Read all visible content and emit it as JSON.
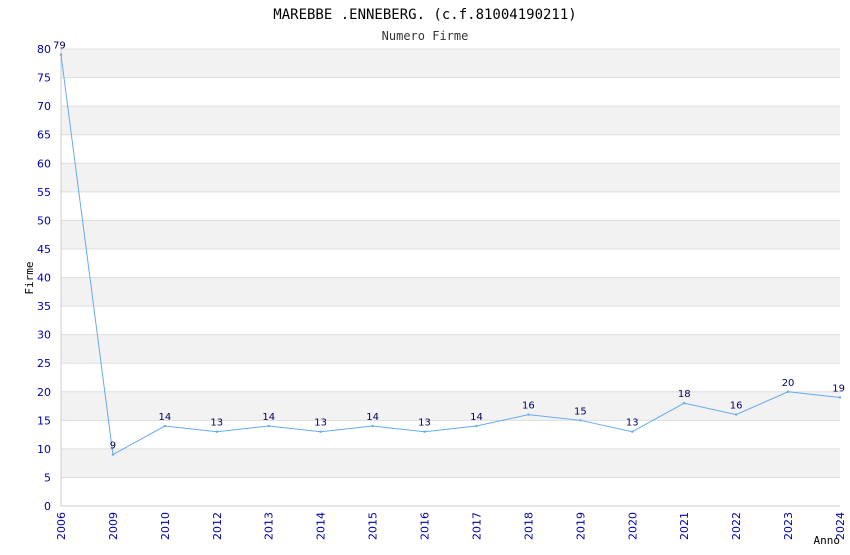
{
  "chart_data": {
    "type": "line",
    "title": "MAREBBE .ENNEBERG. (c.f.81004190211)",
    "subtitle": "Numero Firme",
    "xlabel": "Anno",
    "ylabel": "Firme",
    "ylim": [
      0,
      80
    ],
    "yticks": [
      0,
      5,
      10,
      15,
      20,
      25,
      30,
      35,
      40,
      45,
      50,
      55,
      60,
      65,
      70,
      75,
      80
    ],
    "categories": [
      "2006",
      "2009",
      "2010",
      "2012",
      "2013",
      "2014",
      "2015",
      "2016",
      "2017",
      "2018",
      "2019",
      "2020",
      "2021",
      "2022",
      "2023",
      "2024"
    ],
    "values": [
      79,
      9,
      14,
      13,
      14,
      13,
      14,
      13,
      14,
      16,
      15,
      13,
      18,
      16,
      20,
      19
    ],
    "grid": true,
    "band_colors": [
      "#f2f2f2",
      "#ffffff"
    ],
    "line_color": "#66aaee",
    "tick_color": "#0000aa",
    "label_color": "#000066"
  }
}
